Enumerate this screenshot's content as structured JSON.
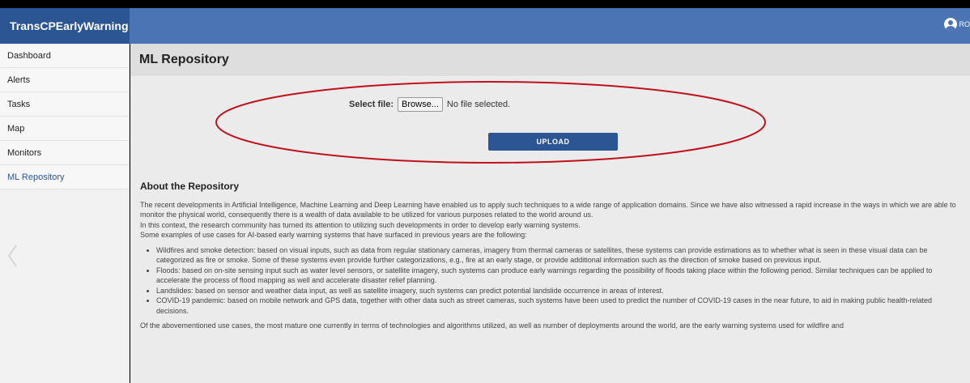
{
  "app": {
    "title": "TransCPEarlyWarning",
    "user_initials": "RO"
  },
  "sidebar": {
    "items": [
      {
        "label": "Dashboard"
      },
      {
        "label": "Alerts"
      },
      {
        "label": "Tasks"
      },
      {
        "label": "Map"
      },
      {
        "label": "Monitors"
      },
      {
        "label": "ML Repository",
        "active": true
      }
    ]
  },
  "main": {
    "page_title": "ML Repository",
    "upload": {
      "select_label": "Select file:",
      "browse_label": "Browse...",
      "no_file_text": "No file selected.",
      "upload_label": "UPLOAD"
    },
    "about": {
      "heading": "About the Repository",
      "para1": "The recent developments in Artificial Intelligence, Machine Learning and Deep Learning have enabled us to apply such techniques to a wide range of application domains. Since we have also witnessed a rapid increase in the ways in which we are able to monitor the physical world, consequently there is a wealth of data available to be utilized for various purposes related to the world around us.",
      "para2": "In this context, the research community has turned its attention to utilizing such developments in order to develop early warning systems.",
      "para3": "Some examples of use cases for AI-based early warning systems that have surfaced in previous years are the following:",
      "bullets": [
        "Wildfires and smoke detection: based on visual inputs, such as data from regular stationary cameras, imagery from thermal cameras or satellites, these systems can provide estimations as to whether what is seen in these visual data can be categorized as fire or smoke. Some of these systems even provide further categorizations, e.g., fire at an early stage, or provide additional information such as the direction of smoke based on previous input.",
        "Floods: based on on-site sensing input such as water level sensors, or satellite imagery, such systems can produce early warnings regarding the possibility of floods taking place within the following period. Similar techniques can be applied to accelerate the process of flood mapping as well and accelerate disaster relief planning.",
        "Landslides: based on sensor and weather data input, as well as satellite imagery, such systems can predict potential landslide occurrence in areas of interest.",
        "COVID-19 pandemic: based on mobile network and GPS data, together with other data such as street cameras, such systems have been used to predict the number of COVID-19 cases in the near future, to aid in making public health-related decisions."
      ],
      "para4": "Of the abovementioned use cases, the most mature one currently in terms of technologies and algorithms utilized, as well as number of deployments around the world, are the early warning systems used for wildfire and"
    }
  },
  "colors": {
    "appbar": "#4a74b3",
    "brand": "#2c5593",
    "annotation": "#c0101a"
  },
  "icons": {
    "user": "user-icon",
    "collapse": "chevron-left-icon"
  }
}
